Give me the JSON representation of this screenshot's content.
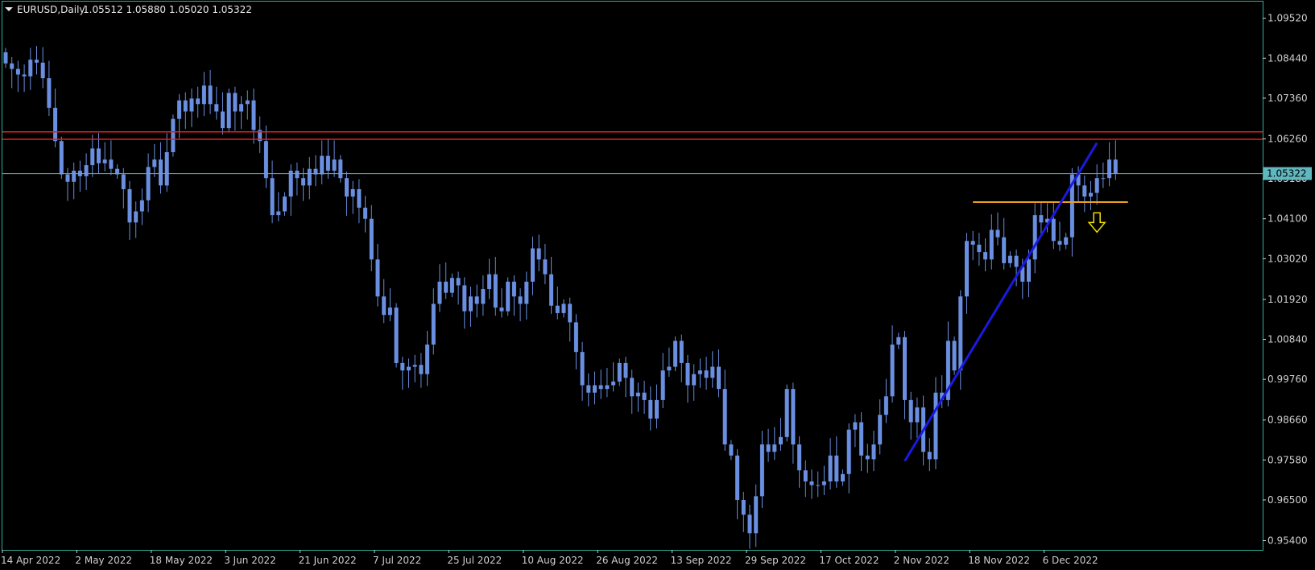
{
  "window": {
    "symbol_label": "EURUSD,Daily",
    "ohlc_label": "1.05512 1.05880 1.05020 1.05322"
  },
  "colors": {
    "background": "#000000",
    "frame": "#2fae9a",
    "candle": "#6a8fe0",
    "candle_wick": "#6a8fe0",
    "resistance": "#e02020",
    "support": "#f0a020",
    "trendline": "#1a1ae0",
    "arrow": "#f0e000",
    "current_price": "#6fa8a8",
    "price_tag_bg": "#5fb8c0"
  },
  "chart_data": {
    "type": "candlestick",
    "symbol": "EURUSD",
    "timeframe": "Daily",
    "last_ohlc": {
      "open": 1.05512,
      "high": 1.0588,
      "low": 1.0502,
      "close": 1.05322
    },
    "current_price": 1.05322,
    "current_price_label": "1.05322",
    "y_range": [
      0.9515,
      1.0997
    ],
    "y_ticks": [
      {
        "value": 1.0952,
        "label": "1.09520"
      },
      {
        "value": 1.0844,
        "label": "1.08440"
      },
      {
        "value": 1.0736,
        "label": "1.07360"
      },
      {
        "value": 1.0626,
        "label": "1.06260"
      },
      {
        "value": 1.0518,
        "label": "1.05180"
      },
      {
        "value": 1.041,
        "label": "1.04100"
      },
      {
        "value": 1.0302,
        "label": "1.03020"
      },
      {
        "value": 1.0192,
        "label": "1.01920"
      },
      {
        "value": 1.0084,
        "label": "1.00840"
      },
      {
        "value": 0.9976,
        "label": "0.99760"
      },
      {
        "value": 0.9866,
        "label": "0.98660"
      },
      {
        "value": 0.9758,
        "label": "0.97580"
      },
      {
        "value": 0.965,
        "label": "0.96500"
      },
      {
        "value": 0.954,
        "label": "0.95400"
      }
    ],
    "x_ticks": [
      {
        "index": 0,
        "label": "14 Apr 2022"
      },
      {
        "index": 12,
        "label": "2 May 2022"
      },
      {
        "index": 24,
        "label": "18 May 2022"
      },
      {
        "index": 36,
        "label": "3 Jun 2022"
      },
      {
        "index": 48,
        "label": "21 Jun 2022"
      },
      {
        "index": 60,
        "label": "7 Jul 2022"
      },
      {
        "index": 72,
        "label": "25 Jul 2022"
      },
      {
        "index": 84,
        "label": "10 Aug 2022"
      },
      {
        "index": 96,
        "label": "26 Aug 2022"
      },
      {
        "index": 108,
        "label": "13 Sep 2022"
      },
      {
        "index": 120,
        "label": "29 Sep 2022"
      },
      {
        "index": 132,
        "label": "17 Oct 2022"
      },
      {
        "index": 144,
        "label": "2 Nov 2022"
      },
      {
        "index": 156,
        "label": "18 Nov 2022"
      },
      {
        "index": 168,
        "label": "6 Dec 2022"
      }
    ],
    "closes": [
      1.083,
      1.0815,
      1.08,
      1.0795,
      1.084,
      1.0832,
      1.079,
      1.071,
      1.062,
      1.053,
      1.051,
      1.054,
      1.0525,
      1.0555,
      1.06,
      1.056,
      1.057,
      1.0545,
      1.053,
      1.049,
      1.04,
      1.043,
      1.046,
      1.055,
      1.057,
      1.05,
      1.059,
      1.068,
      1.073,
      1.07,
      1.0735,
      1.072,
      1.077,
      1.072,
      1.07,
      1.0655,
      1.075,
      1.07,
      1.072,
      1.073,
      1.065,
      1.062,
      1.052,
      1.042,
      1.043,
      1.047,
      1.054,
      1.052,
      1.05,
      1.0545,
      1.053,
      1.058,
      1.054,
      1.057,
      1.052,
      1.047,
      1.049,
      1.044,
      1.041,
      1.03,
      1.02,
      1.015,
      1.017,
      1.002,
      1.0,
      1.001,
      1.0015,
      0.999,
      1.007,
      1.018,
      1.024,
      1.021,
      1.025,
      1.023,
      1.016,
      1.02,
      1.018,
      1.022,
      1.026,
      1.017,
      1.016,
      1.024,
      1.02,
      1.018,
      1.024,
      1.033,
      1.03,
      1.026,
      1.0175,
      1.0155,
      1.018,
      1.013,
      1.005,
      0.996,
      0.994,
      0.996,
      0.995,
      0.996,
      0.997,
      1.002,
      0.998,
      0.993,
      0.994,
      0.992,
      0.987,
      0.992,
      1.0,
      1.001,
      1.008,
      1.002,
      0.996,
      0.999,
      1.0,
      0.998,
      1.001,
      0.995,
      0.98,
      0.977,
      0.965,
      0.961,
      0.956,
      0.966,
      0.98,
      0.978,
      0.98,
      0.982,
      0.995,
      0.98,
      0.973,
      0.97,
      0.969,
      0.969,
      0.97,
      0.977,
      0.97,
      0.972,
      0.984,
      0.986,
      0.977,
      0.976,
      0.98,
      0.988,
      0.993,
      1.007,
      1.009,
      0.992,
      0.986,
      0.99,
      0.978,
      0.976,
      0.994,
      0.992,
      1.008,
      1.0,
      1.02,
      1.035,
      1.034,
      1.032,
      1.03,
      1.038,
      1.036,
      1.029,
      1.031,
      1.028,
      1.024,
      1.03,
      1.042,
      1.04,
      1.041,
      1.035,
      1.034,
      1.036,
      1.053,
      1.05,
      1.047,
      1.048,
      1.052,
      1.052,
      1.057,
      1.0532
    ],
    "resistance_levels": [
      1.0645,
      1.0625
    ],
    "support_line": {
      "value": 1.0455,
      "start_index": 156,
      "end_index": 181
    },
    "trendline": {
      "start_index": 145,
      "start_value": 0.9755,
      "end_index": 176,
      "end_value": 1.0615
    },
    "down_arrow": {
      "index": 176,
      "value": 1.04
    }
  }
}
